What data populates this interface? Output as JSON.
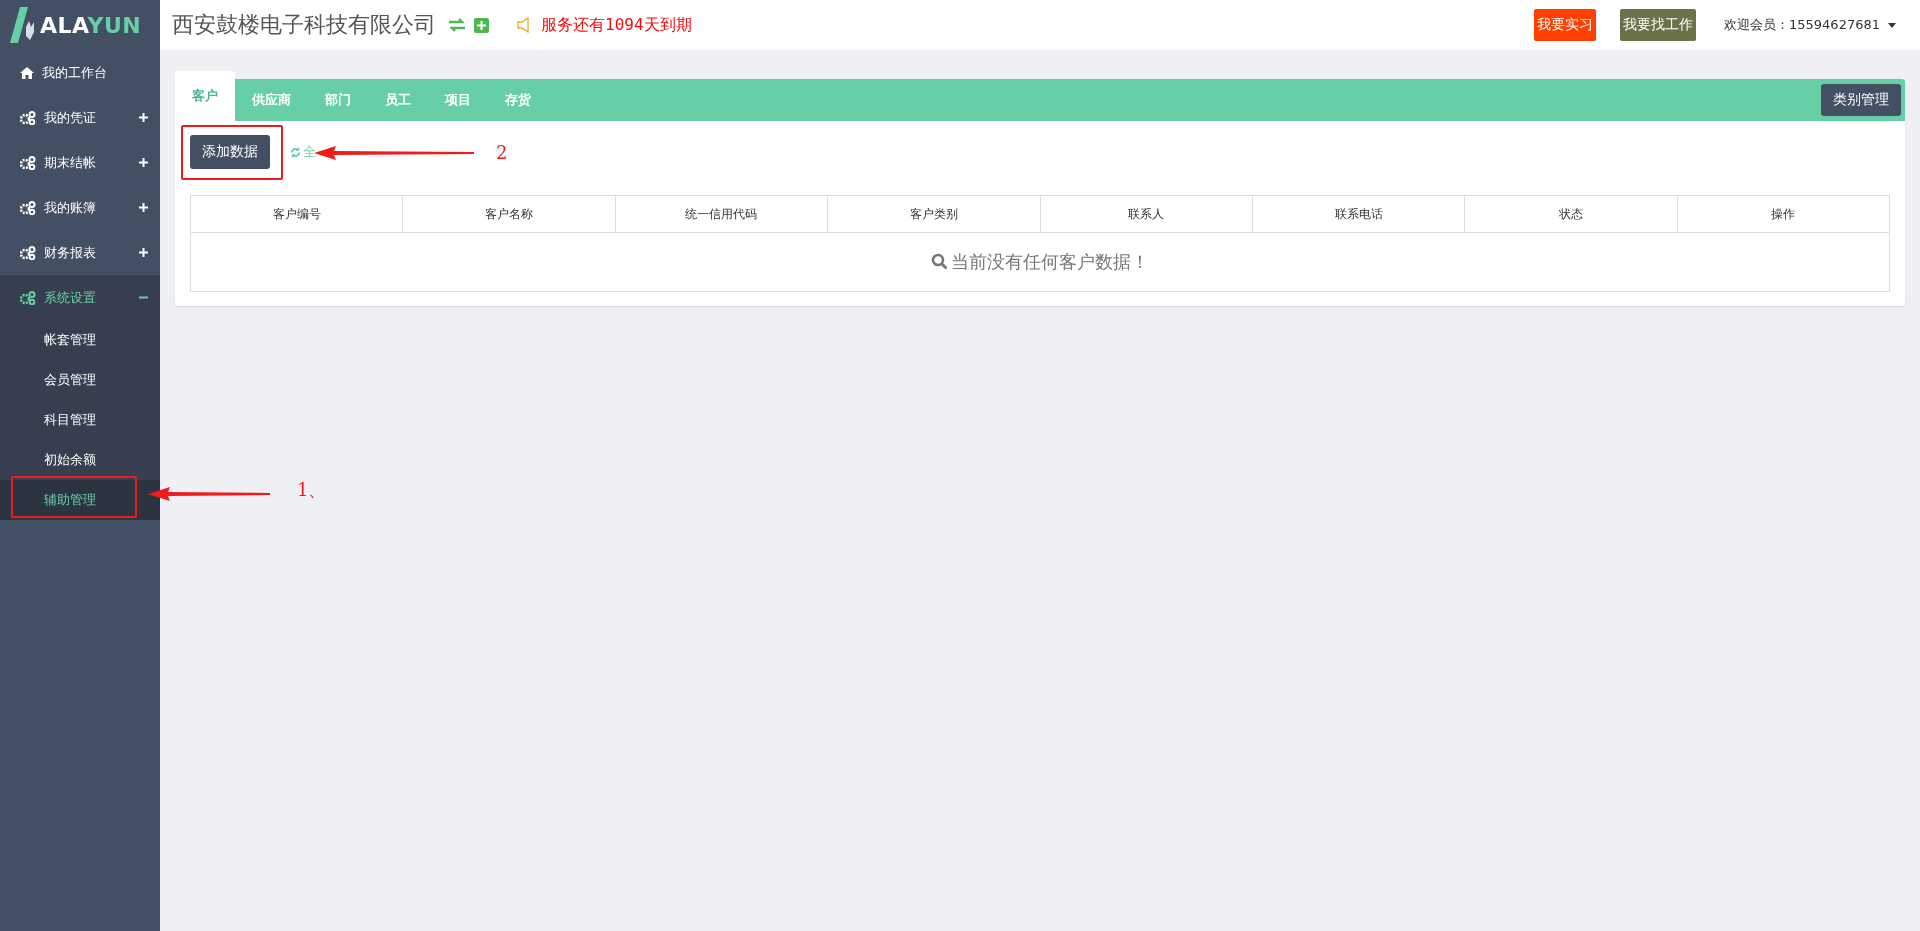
{
  "header": {
    "logo": [
      "ALA",
      "YUN"
    ],
    "company": "西安鼓楼电子科技有限公司",
    "notice": "服务还有1094天到期",
    "buttons": [
      {
        "label": "我要实习",
        "kind": "primary"
      },
      {
        "label": "我要找工作",
        "kind": "secondary"
      }
    ],
    "user": "欢迎会员：15594627681"
  },
  "sidebar": {
    "items": [
      {
        "label": "我的工作台",
        "kind": "link"
      },
      {
        "label": "我的凭证",
        "kind": "menu",
        "expanded": false
      },
      {
        "label": "期末结帐",
        "kind": "menu",
        "expanded": false
      },
      {
        "label": "我的账簿",
        "kind": "menu",
        "expanded": false
      },
      {
        "label": "财务报表",
        "kind": "menu",
        "expanded": false
      },
      {
        "label": "系统设置",
        "kind": "menu",
        "expanded": true,
        "children": [
          {
            "label": "帐套管理",
            "selected": false
          },
          {
            "label": "会员管理",
            "selected": false
          },
          {
            "label": "科目管理",
            "selected": false
          },
          {
            "label": "初始余额",
            "selected": false
          },
          {
            "label": "辅助管理",
            "selected": true
          }
        ]
      }
    ]
  },
  "tabs": [
    {
      "label": "客户",
      "selected": true
    },
    {
      "label": "供应商",
      "selected": false
    },
    {
      "label": "部门",
      "selected": false
    },
    {
      "label": "员工",
      "selected": false
    },
    {
      "label": "项目",
      "selected": false
    },
    {
      "label": "存货",
      "selected": false
    }
  ],
  "category_button": "类别管理",
  "toolbar": {
    "add_button": "添加数据",
    "import_link": "全"
  },
  "table": {
    "columns": [
      "客户编号",
      "客户名称",
      "统一信用代码",
      "客户类别",
      "联系人",
      "联系电话",
      "状态",
      "操作"
    ],
    "empty_message": "当前没有任何客户数据！"
  },
  "annotations": [
    {
      "label": "2"
    },
    {
      "label": "1、"
    }
  ]
}
